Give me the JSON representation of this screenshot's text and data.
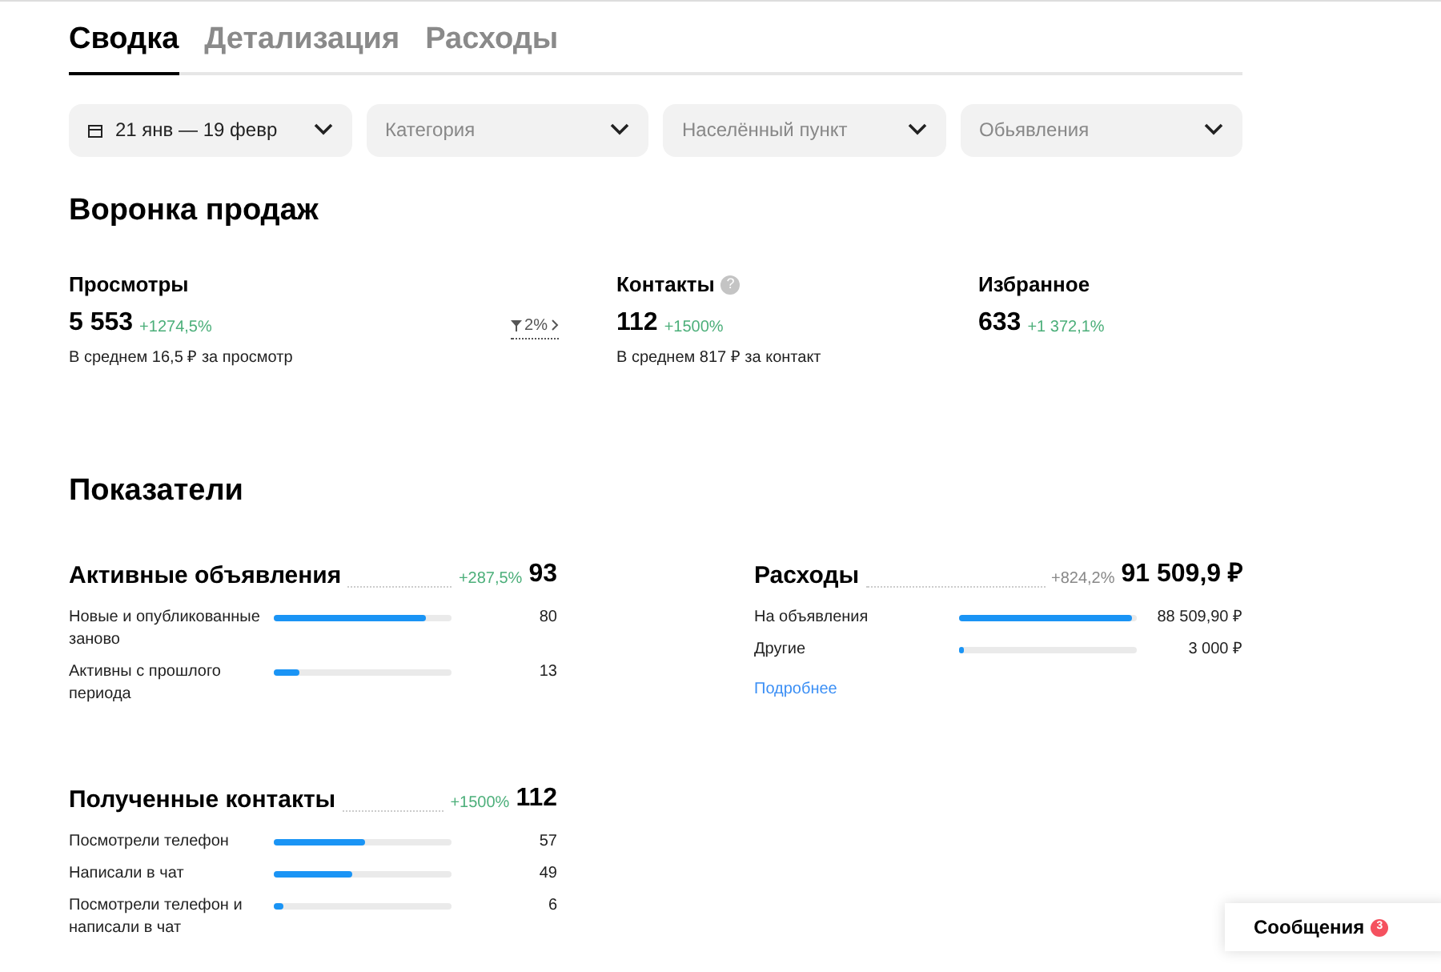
{
  "tabs": [
    {
      "label": "Сводка",
      "selected": true
    },
    {
      "label": "Детализация",
      "selected": false
    },
    {
      "label": "Расходы",
      "selected": false
    }
  ],
  "filters": [
    {
      "kind": "date",
      "value": "21 янв — 19 февр"
    },
    {
      "kind": "select",
      "placeholder": "Категория"
    },
    {
      "kind": "select",
      "placeholder": "Населённый пункт"
    },
    {
      "kind": "select",
      "placeholder": "Обьявления"
    }
  ],
  "funnel": {
    "title": "Воронка продаж",
    "metrics": [
      {
        "label": "Просмотры",
        "value": "5 553",
        "change": "+1274,5%",
        "note": "В среднем 16,5 ₽ за просмотр",
        "conversion": "2%"
      },
      {
        "label": "Контакты",
        "value": "112",
        "change": "+1500%",
        "note": "В среднем 817 ₽ за контакт",
        "help": "?"
      },
      {
        "label": "Избранное",
        "value": "633",
        "change": "+1 372,1%"
      }
    ]
  },
  "indicators": {
    "title": "Показатели",
    "blocks": [
      {
        "title": "Активные объявления",
        "change": "+287,5%",
        "change_positive": true,
        "total": "93",
        "rows": [
          {
            "label": "Новые и опубликованные заново",
            "level": 0.86,
            "value": "80"
          },
          {
            "label": "Активны с прошлого периода",
            "level": 0.14,
            "value": "13"
          }
        ]
      },
      {
        "title": "Расходы",
        "change": "+824,2%",
        "change_positive": false,
        "total": "91 509,9 ₽",
        "rows": [
          {
            "label": "На объявления",
            "level": 0.97,
            "value": "88 509,90 ₽"
          },
          {
            "label": "Другие",
            "level": 0.03,
            "value": "3 000 ₽"
          }
        ],
        "link": "Подробнее"
      },
      {
        "title": "Полученные контакты",
        "change": "+1500%",
        "change_positive": true,
        "total": "112",
        "rows": [
          {
            "label": "Посмотрели телефон",
            "level": 0.51,
            "value": "57"
          },
          {
            "label": "Написали в чат",
            "level": 0.44,
            "value": "49"
          },
          {
            "label": "Посмотрели телефон и написали в чат",
            "level": 0.05,
            "value": "6"
          }
        ]
      }
    ]
  },
  "messages": {
    "label": "Сообщения",
    "count": "3"
  }
}
